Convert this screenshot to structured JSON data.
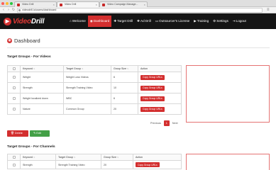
{
  "browser": {
    "tabs": [
      {
        "label": "Video Drill",
        "active": false
      },
      {
        "label": "Video Drill",
        "active": true
      },
      {
        "label": "Video Campaign Manage...",
        "active": false
      }
    ],
    "url": "videodrill.io/users/dashboard"
  },
  "navbar": {
    "logo_prefix": "Video",
    "logo_suffix": "Drill",
    "items": [
      {
        "label": "Welcome",
        "icon": "home-icon",
        "active": false
      },
      {
        "label": "Dashboard",
        "icon": "dashboard-icon",
        "active": true
      },
      {
        "label": "Target Drill",
        "icon": "plus-icon",
        "active": false
      },
      {
        "label": "Ad Drill",
        "icon": "plus-icon",
        "active": false
      },
      {
        "label": "Outsourcer's License",
        "icon": "card-icon",
        "active": false
      },
      {
        "label": "Training",
        "icon": "video-icon",
        "active": false
      },
      {
        "label": "Settings",
        "icon": "gear-icon",
        "active": false
      },
      {
        "label": "Logout",
        "icon": "logout-icon",
        "active": false
      }
    ]
  },
  "page": {
    "title": "Dashboard"
  },
  "videos_section": {
    "title": "Target Groups - For Videos",
    "columns": [
      "Keyword",
      "Target Group",
      "Group Size",
      "Action"
    ],
    "rows": [
      {
        "keyword": "Weight",
        "group": "Weight Loss Videos",
        "size": "6",
        "action": "Copy Group URLs"
      },
      {
        "keyword": "Strength",
        "group": "Strength Training Video",
        "size": "10",
        "action": "Copy Group URLs"
      },
      {
        "keyword": "Weight localized down",
        "group": "WBC",
        "size": "6",
        "action": "Copy Group URLs"
      },
      {
        "keyword": "Nature",
        "group": "Common Group",
        "size": "20",
        "action": "Copy Group URLs"
      }
    ],
    "pagination": {
      "previous": "Previous",
      "current": "1",
      "next": "Next"
    }
  },
  "actions": {
    "delete": "Delete",
    "edit": "Edit"
  },
  "channels_section": {
    "title": "Target Groups - For Channels",
    "columns": [
      "Keyword",
      "Target Group",
      "Group Size",
      "Action"
    ],
    "rows": [
      {
        "keyword": "Strength",
        "group": "Strength Training Video",
        "size": "20",
        "action": "Copy Group URLs"
      }
    ]
  },
  "colors": {
    "accent": "#d32f2f",
    "navbar_bg": "#151515",
    "edit_green": "#43a047"
  }
}
